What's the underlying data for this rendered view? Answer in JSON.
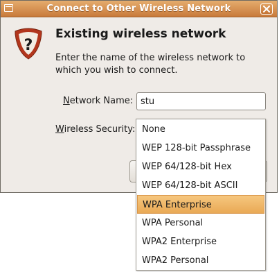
{
  "window": {
    "title": "Connect to Other Wireless Network",
    "accent_color": "#d48a48"
  },
  "dialog": {
    "heading": "Existing wireless network",
    "description": "Enter the name of the wireless network to which you wish to connect.",
    "icon": "warning-question-icon"
  },
  "form": {
    "network_name_label_mnemonic": "N",
    "network_name_label_rest": "etwork Name:",
    "network_name_value": "stu",
    "wireless_security_label_mnemonic": "W",
    "wireless_security_label_rest": "ireless Security:"
  },
  "dropdown": {
    "options": [
      "None",
      "WEP 128-bit Passphrase",
      "WEP 64/128-bit Hex",
      "WEP 64/128-bit ASCII",
      "WPA Enterprise",
      "WPA Personal",
      "WPA2 Enterprise",
      "WPA2 Personal"
    ],
    "highlighted": "WPA Enterprise",
    "highlight_color": "#f0b96a"
  }
}
